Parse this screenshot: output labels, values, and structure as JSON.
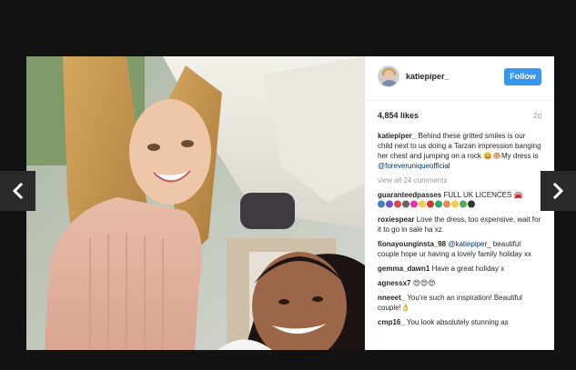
{
  "post": {
    "username": "katiepiper_",
    "follow_label": "Follow",
    "likes": "4,854 likes",
    "time_ago": "2d",
    "caption": {
      "username": "katiepiper_",
      "text": "Behind these gritted smiles is our child next to us doing a Tarzan impression banging her chest and jumping on a rock 😄🐵My dress is",
      "mention": "@foreveruniqueofficial"
    },
    "view_all": "view all 24 comments",
    "comments": [
      {
        "user": "guaranteedpasses",
        "text": "FULL UK LICENCES 🚘"
      },
      {
        "user": "roxiespear",
        "text": "Love the dress, too expensive, wait for it to go in sale ha xz."
      },
      {
        "user": "fionayounginsta_98",
        "mention": "@katiepiper_",
        "text": "beautiful couple hope ur having a lovely family holiday xx"
      },
      {
        "user": "gemma_dawn1",
        "text": "Have a great holiday x"
      },
      {
        "user": "agnessx7",
        "text": "😍😍😍"
      },
      {
        "user": "nneeet_",
        "text": "You're such an inspiration! Beautiful couple!👌"
      },
      {
        "user": "cmp16_",
        "text": "You look absolutely stunning as"
      }
    ]
  },
  "icons": {
    "prev": "chevron-left-icon",
    "next": "chevron-right-icon",
    "avatar": "profile-avatar"
  },
  "colors": {
    "backdrop": "#121212",
    "follow_button": "#3897f0",
    "link": "#003569",
    "nav_button": "#2a2a2a"
  }
}
